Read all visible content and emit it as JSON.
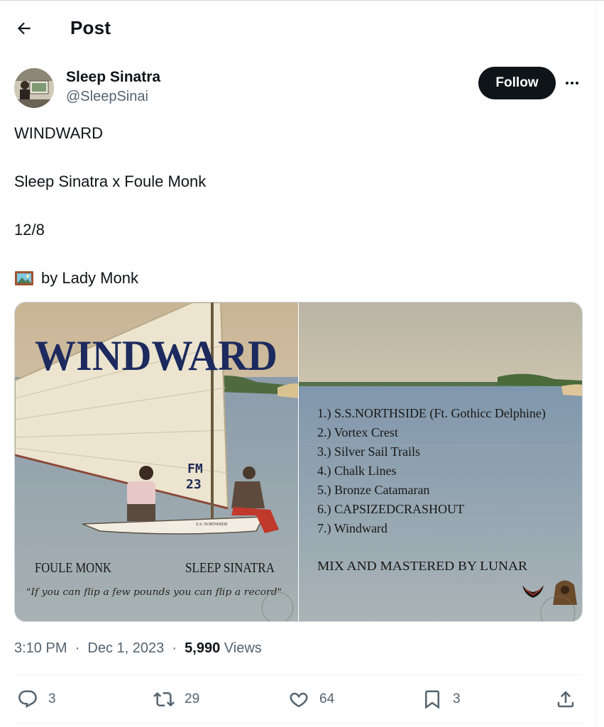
{
  "header": {
    "title": "Post"
  },
  "author": {
    "display_name": "Sleep Sinatra",
    "handle": "@SleepSinai",
    "follow_label": "Follow"
  },
  "post": {
    "lines": [
      "WINDWARD",
      "Sleep Sinatra x Foule Monk",
      "12/8",
      "by Lady Monk"
    ],
    "emoji": "🖼️"
  },
  "media": {
    "cover": {
      "title": "WINDWARD",
      "sail_mark": [
        "FM",
        "23"
      ],
      "boat_name": "S.S. NORTHSIDE",
      "artist_left": "FOULE MONK",
      "artist_right": "SLEEP SINATRA",
      "quote": "\"If you can flip a few pounds you can flip a record\""
    },
    "back": {
      "tracks": [
        "1.) S.S.NORTHSIDE (Ft. Gothicc Delphine)",
        "2.) Vortex Crest",
        "3.) Silver Sail Trails",
        "4.) Chalk Lines",
        "5.) Bronze Catamaran",
        "6.) CAPSIZEDCRASHOUT",
        "7.) Windward"
      ],
      "credit": "MIX AND MASTERED BY LUNAR"
    }
  },
  "meta": {
    "time": "3:10 PM",
    "date": "Dec 1, 2023",
    "views_count": "5,990",
    "views_label": "Views"
  },
  "actions": {
    "replies": "3",
    "reposts": "29",
    "likes": "64",
    "bookmarks": "3"
  },
  "colors": {
    "text": "#0f1419",
    "secondary": "#536471",
    "follow_bg": "#0f1419",
    "divider": "#eff3f4"
  }
}
